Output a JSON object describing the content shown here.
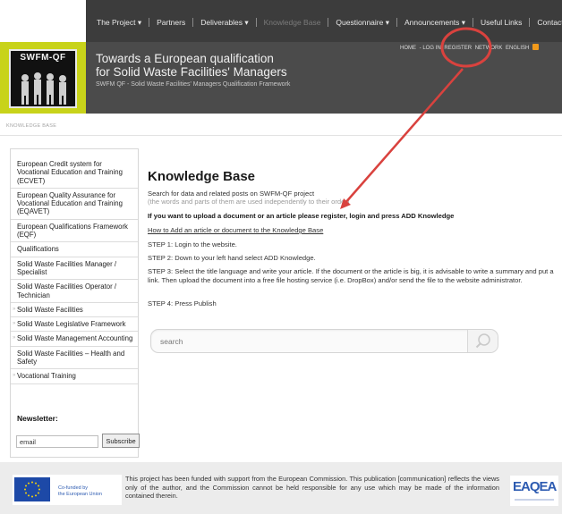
{
  "nav": {
    "items": [
      {
        "label": "The Project ▾",
        "muted": false
      },
      {
        "label": "Partners",
        "muted": false
      },
      {
        "label": "Deliverables ▾",
        "muted": false
      },
      {
        "label": "Knowledge Base",
        "muted": true
      },
      {
        "label": "Questionnaire ▾",
        "muted": false
      },
      {
        "label": "Announcements ▾",
        "muted": false
      },
      {
        "label": "Useful Links",
        "muted": false
      },
      {
        "label": "Contact us",
        "muted": false
      }
    ]
  },
  "header": {
    "logo_text": "SWFM-QF",
    "title_line1": "Towards a European qualification",
    "title_line2": "for Solid Waste Facilities' Managers",
    "subtitle": "SWFM QF - Solid Waste Facilities' Managers Qualification Framework",
    "util_links": [
      "HOME",
      "- LOG IN",
      "REGISTER",
      "NETWORK",
      "ENGLISH"
    ]
  },
  "breadcrumb": "KNOWLEDGE BASE",
  "sidebar": {
    "items": [
      {
        "label": "European Credit system for Vocational Education and Training (ECVET)",
        "marker": ""
      },
      {
        "label": "European Quality Assurance for Vocational Education and Training (EQAVET)",
        "marker": ""
      },
      {
        "label": "European Qualifications Framework (EQF)",
        "marker": ""
      },
      {
        "label": "Qualifications",
        "marker": ""
      },
      {
        "label": "Solid Waste Facilities Manager / Specialist",
        "marker": ""
      },
      {
        "label": "Solid Waste Facilities Operator / Technician",
        "marker": ""
      },
      {
        "label": "Solid Waste Facilities",
        "marker": "»"
      },
      {
        "label": "Solid Waste Legislative Framework",
        "marker": "»"
      },
      {
        "label": "Solid Waste Management Accounting",
        "marker": "»"
      },
      {
        "label": "Solid Waste Facilities – Health and Safety",
        "marker": ""
      },
      {
        "label": "Vocational Training",
        "marker": "»"
      }
    ],
    "newsletter_label": "Newsletter:",
    "email_value": "email",
    "subscribe_label": "Subscribe"
  },
  "main": {
    "title": "Knowledge Base",
    "intro": "Search for data and related posts on SWFM-QF project",
    "intro_note": "(the words and parts of them are used independently to their order)",
    "upload_text": "If you want to upload a document or an article please register, login and press ADD Knowledge",
    "how_to_link": "How to Add an article or document to the Knowledge Base",
    "step1": "STEP 1: Login to the website.",
    "step2": "STEP 2: Down to your left hand select ADD Knowledge.",
    "step3": "STEP 3: Select the title language and write your article. If the document or the article is big, it is advisable to write a summary and put a link. Then upload the document into a free file hosting service (i.e. DropBox) and/or send the file to the website administrator.",
    "step4": "STEP 4: Press Publish",
    "search_placeholder": "search"
  },
  "footer": {
    "cofunded_line1": "Co-funded by",
    "cofunded_line2": "the European Union",
    "text": "This project has been funded with support from the European Commission. This publication [communication] reflects the views only of the author, and the Commission cannot be held responsible for any use which may be made of the information contained therein.",
    "partner_logo_text": "EAQEA"
  },
  "colors": {
    "nav_bg": "#3c3c3c",
    "banner_bg": "#4b4b4b",
    "logo_accent": "#c8d31a",
    "annotation_red": "#d9423e",
    "eu_blue": "#1d49a7"
  }
}
